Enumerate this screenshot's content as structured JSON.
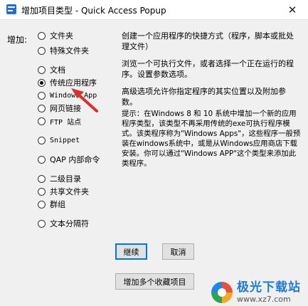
{
  "window": {
    "title": "增加项目类型 - Quick Access Popup",
    "close_glyph": "✕"
  },
  "add_label": "增加:",
  "options": [
    {
      "label": "文件夹",
      "checked": false
    },
    {
      "label": "特殊文件夹",
      "checked": false
    },
    {
      "label": "文档",
      "checked": false
    },
    {
      "label": "传统应用程序",
      "checked": true
    },
    {
      "label": "Windows App",
      "checked": false
    },
    {
      "label": "网页链接",
      "checked": false
    },
    {
      "label": "FTP 站点",
      "checked": false
    },
    {
      "label": "Snippet",
      "checked": false
    },
    {
      "label": "QAP 内部命令",
      "checked": false
    },
    {
      "label": "二级目录",
      "checked": false
    },
    {
      "label": "共享文件夹",
      "checked": false
    },
    {
      "label": "群组",
      "checked": false
    },
    {
      "label": "文本分隔符",
      "checked": false
    }
  ],
  "description": {
    "p1": "创建一个应用程序的快捷方式（程序，脚本或批处理文件）",
    "p2": "浏览一个可执行文件，或者选择一个正在运行的程序。设置参数选项。",
    "p3": "高级选项允许你指定程序的其实位置以及附加参数。",
    "p4": "提示：在Windows 8 和 10 系统中增加一个新的应用程序类型，该类型不再采用传统的exe可执行程序模式。该类程序称为\"Windows Apps\"，这些程序一般预装在windows系统中，或是从Windows应用商店下载安装。你可以通过\"Windows APP\"这个类型来添加此类程序。"
  },
  "buttons": {
    "continue": "继续",
    "cancel": "取消",
    "add_multiple": "增加多个收藏项目"
  },
  "watermark": {
    "name": "极光下载站",
    "url": "www.xz7.com"
  },
  "colors": {
    "panel_bg": "#f0f0f0",
    "default_button_border": "#0078d7",
    "arrow": "#d9302c"
  }
}
